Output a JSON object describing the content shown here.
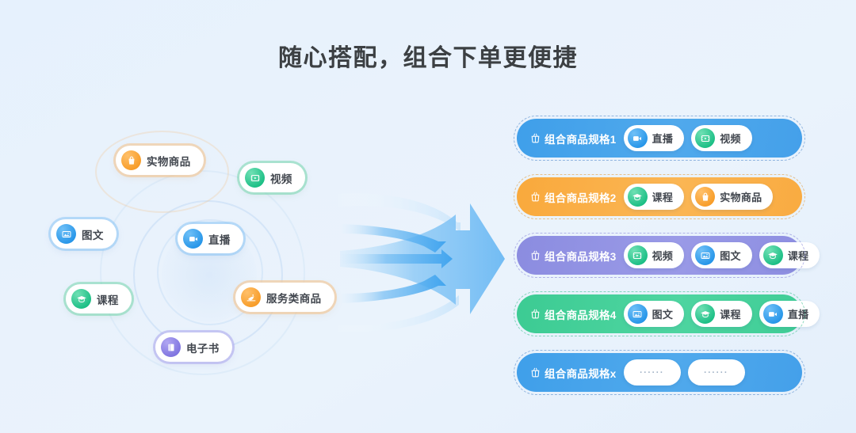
{
  "page": {
    "title": "随心搭配，组合下单更便捷",
    "background_color": "#e7f1fc"
  },
  "colors": {
    "blue": "#3f9fea",
    "orange": "#f9ab3f",
    "purple": "#8b8ce0",
    "green": "#3fcb93"
  },
  "source_pills": [
    {
      "label": "实物商品",
      "icon": "shopping-bag-icon",
      "color": "orange"
    },
    {
      "label": "视频",
      "icon": "video-frame-icon",
      "color": "green"
    },
    {
      "label": "图文",
      "icon": "image-text-icon",
      "color": "blue"
    },
    {
      "label": "直播",
      "icon": "live-camera-icon",
      "color": "blue"
    },
    {
      "label": "课程",
      "icon": "graduation-cap-icon",
      "color": "green"
    },
    {
      "label": "服务类商品",
      "icon": "service-hand-icon",
      "color": "orange"
    },
    {
      "label": "电子书",
      "icon": "book-icon",
      "color": "purple"
    }
  ],
  "arrow": {
    "name": "merge-arrow-right",
    "color": "#7cc2f3"
  },
  "combo_rows": [
    {
      "title": "组合商品规格1",
      "color": "blue",
      "icon": "combo-bag-icon",
      "chips": [
        {
          "label": "直播",
          "icon": "live-camera-icon",
          "color": "blue"
        },
        {
          "label": "视频",
          "icon": "video-frame-icon",
          "color": "green"
        }
      ]
    },
    {
      "title": "组合商品规格2",
      "color": "orange",
      "icon": "combo-bag-icon",
      "chips": [
        {
          "label": "课程",
          "icon": "graduation-cap-icon",
          "color": "green"
        },
        {
          "label": "实物商品",
          "icon": "shopping-bag-icon",
          "color": "orange"
        }
      ]
    },
    {
      "title": "组合商品规格3",
      "color": "purple",
      "icon": "combo-bag-icon",
      "chips": [
        {
          "label": "视频",
          "icon": "video-frame-icon",
          "color": "green"
        },
        {
          "label": "图文",
          "icon": "image-text-icon",
          "color": "blue"
        },
        {
          "label": "课程",
          "icon": "graduation-cap-icon",
          "color": "green"
        }
      ]
    },
    {
      "title": "组合商品规格4",
      "color": "green",
      "icon": "combo-bag-icon",
      "chips": [
        {
          "label": "图文",
          "icon": "image-text-icon",
          "color": "blue"
        },
        {
          "label": "课程",
          "icon": "graduation-cap-icon",
          "color": "green"
        },
        {
          "label": "直播",
          "icon": "live-camera-icon",
          "color": "blue"
        }
      ]
    },
    {
      "title": "组合商品规格x",
      "color": "blue",
      "icon": "combo-bag-icon",
      "chips": [
        {
          "label": "······",
          "icon": "none",
          "color": "none",
          "placeholder": true
        },
        {
          "label": "······",
          "icon": "none",
          "color": "none",
          "placeholder": true
        }
      ]
    }
  ]
}
